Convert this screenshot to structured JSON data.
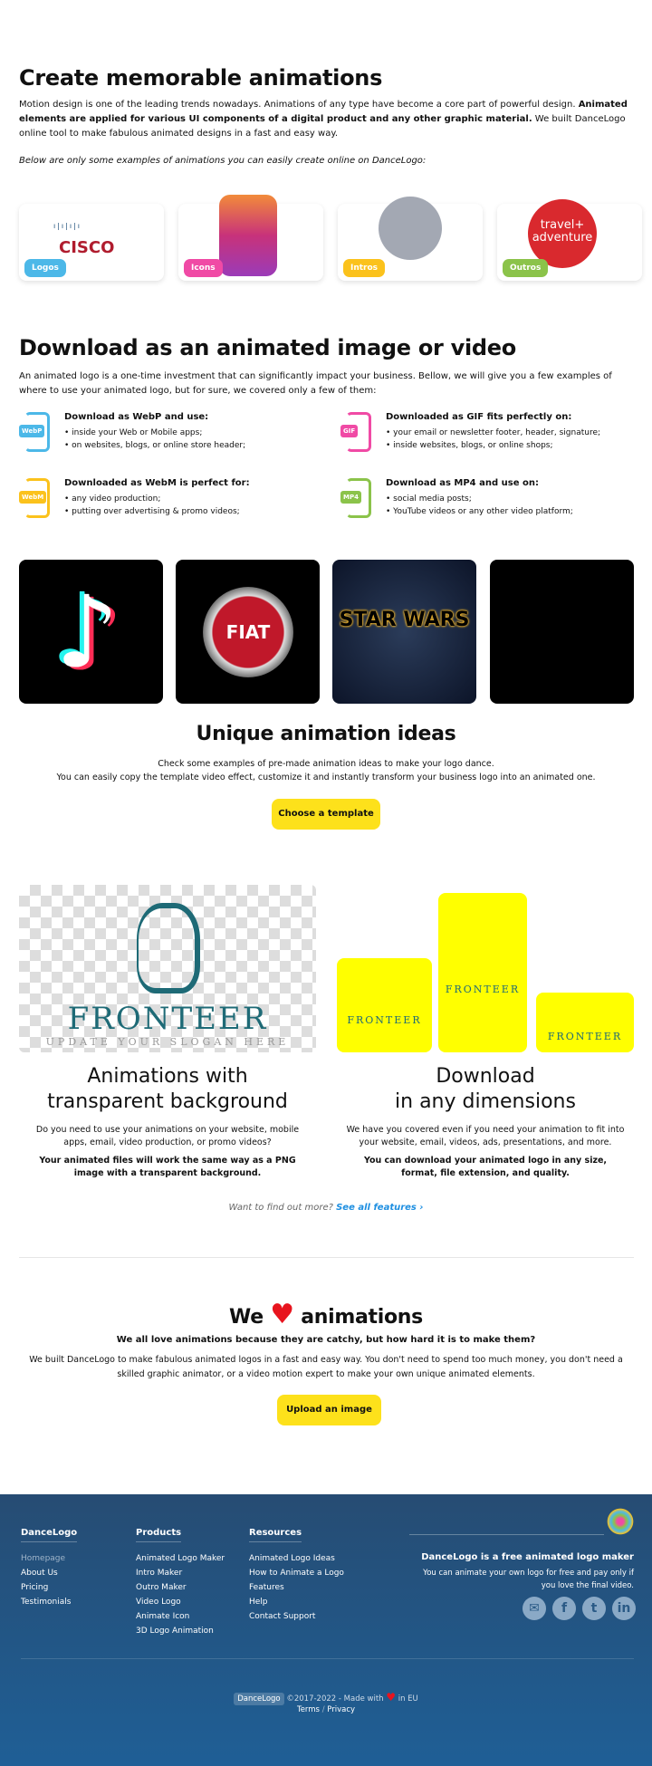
{
  "intro": {
    "title": "Create memorable animations",
    "p1_start": "Motion design is one of the leading trends nowadays. Animations of any type have become a core part of powerful design. ",
    "p1_bold": "Animated elements are applied for various UI components of a digital product and any other graphic material.",
    "p1_end": " We built DanceLogo online tool to make fabulous animated designs in a fast and easy way.",
    "p2": "Below are only some examples of animations you can easily create online on DanceLogo:",
    "cards": [
      {
        "label": "Logos",
        "color": "#4cb8e8",
        "logo": "cisco"
      },
      {
        "label": "Icons",
        "color": "#f04aa5",
        "logo": "instagram"
      },
      {
        "label": "Intros",
        "color": "#fbc21c",
        "logo": "emblem"
      },
      {
        "label": "Outros",
        "color": "#8bc34a",
        "logo": "travel + adventure"
      }
    ]
  },
  "download": {
    "title": "Download as an animated image or video",
    "p": "An animated logo is a one-time investment that can significantly impact your business. Bellow, we will give you a few examples of where to use your animated logo, but for sure, we covered only a few of them:",
    "items": [
      {
        "badge": "WebP",
        "color": "#4cb8e8",
        "title": "Download as WebP and use:",
        "bullets": [
          "• inside your Web or Mobile apps;",
          "• on websites, blogs, or online store header;"
        ]
      },
      {
        "badge": "GIF",
        "color": "#f04aa5",
        "title": "Downloaded as GIF fits perfectly on:",
        "bullets": [
          "• your email or newsletter footer, header, signature;",
          "• inside websites, blogs, or online shops;"
        ]
      },
      {
        "badge": "WebM",
        "color": "#fbc21c",
        "title": "Downloaded as WebM is perfect for:",
        "bullets": [
          "• any video production;",
          "• putting over advertising & promo videos;"
        ]
      },
      {
        "badge": "MP4",
        "color": "#8bc34a",
        "title": "Download as MP4 and use on:",
        "bullets": [
          "• social media posts;",
          "• YouTube videos or any other video platform;"
        ]
      }
    ]
  },
  "thumbs": [
    {
      "name": "tiktok"
    },
    {
      "name": "FIAT"
    },
    {
      "name": "STAR WARS"
    },
    {
      "name": "black"
    }
  ],
  "ideas": {
    "title": "Unique animation ideas",
    "l1": "Check some examples of pre-made animation ideas to make your logo dance.",
    "l2": "You can easily copy the template video effect, customize it and instantly transform your business logo into an animated one.",
    "button": "Choose a template"
  },
  "sample": {
    "brand": "FRONTEER",
    "slogan": "UPDATE YOUR SLOGAN HERE"
  },
  "transparent": {
    "t1": "Animations with",
    "t2": "transparent background",
    "p": "Do you need to use your animations on your website, mobile apps, email, video production, or promo videos?",
    "bold": "Your animated files will work the same way as a PNG image with a transparent background."
  },
  "dimensions": {
    "t1": "Download",
    "t2": "in any dimensions",
    "p": "We have you covered even if you need your animation to fit into your website, email, videos, ads, presentations, and more.",
    "bold": "You can download your animated logo in any size, format, file extension, and quality."
  },
  "more": {
    "q": "Want to find out more?",
    "link": "See all features ›"
  },
  "love": {
    "we": "We",
    "rest": "animations",
    "sub": "We all love animations because they are catchy, but how hard it is to make them?",
    "p": "We built DanceLogo to make fabulous animated logos in a fast and easy way. You don't need to spend too much money, you don't need a skilled graphic animator, or a video motion expert to make your own unique animated elements.",
    "button": "Upload an image"
  },
  "footer": {
    "cols": [
      {
        "title": "DanceLogo",
        "items": [
          "Homepage",
          "About Us",
          "Pricing",
          "Testimonials"
        ]
      },
      {
        "title": "Products",
        "items": [
          "Animated Logo Maker",
          "Intro Maker",
          "Outro Maker",
          "Video Logo",
          "Animate Icon",
          "3D Logo Animation"
        ]
      },
      {
        "title": "Resources",
        "items": [
          "Animated Logo Ideas",
          "How to Animate a Logo",
          "Features",
          "Help",
          "Contact Support"
        ]
      }
    ],
    "tagline": "DanceLogo is a free animated logo maker",
    "desc": "You can animate your own logo for free and pay only if you love the final video.",
    "social": [
      "mail-icon",
      "facebook-icon",
      "twitter-icon",
      "linkedin-icon"
    ],
    "brand": "DanceLogo",
    "copy": "©2017-2022 - Made with",
    "eu": "in EU",
    "terms": "Terms",
    "sep": "/",
    "privacy": "Privacy"
  }
}
